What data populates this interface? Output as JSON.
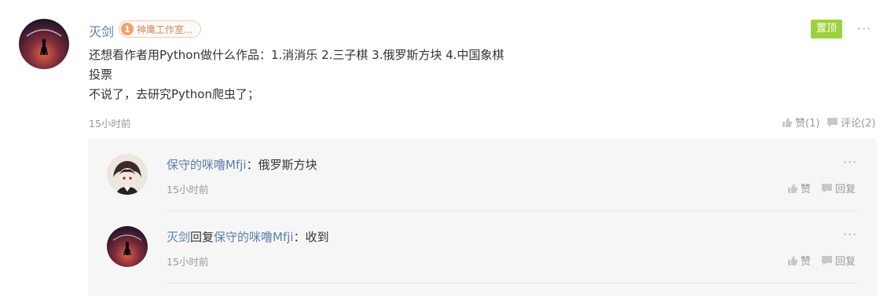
{
  "comment": {
    "author": "灭剑",
    "badge_level": "1",
    "badge_text": "神鹰工作室...",
    "pin_label": "置顶",
    "more_label": "···",
    "lines": [
      "还想看作者用Python做什么作品：1.消消乐 2.三子棋 3.俄罗斯方块 4.中国象棋",
      "投票",
      "不说了，去研究Python爬虫了；"
    ],
    "time": "15小时前",
    "like_label": "赞(1)",
    "comment_label": "评论(2)"
  },
  "replies": [
    {
      "author": "保守的咪噜Mfji",
      "separator": "：",
      "text": "俄罗斯方块",
      "time": "15小时前",
      "like_label": "赞",
      "reply_label": "回复",
      "more_label": "···"
    },
    {
      "author": "灭剑",
      "reply_word": "回复",
      "target": "保守的咪噜Mfji",
      "separator": "：",
      "text": "收到",
      "time": "15小时前",
      "like_label": "赞",
      "reply_label": "回复",
      "more_label": "···"
    }
  ],
  "colors": {
    "link": "#5a7fa8",
    "pin": "#9bd13d",
    "badge": "#f0a070",
    "muted": "#999999"
  },
  "icons": [
    "thumbs-up-icon",
    "comment-bubble-icon",
    "more-icon"
  ]
}
